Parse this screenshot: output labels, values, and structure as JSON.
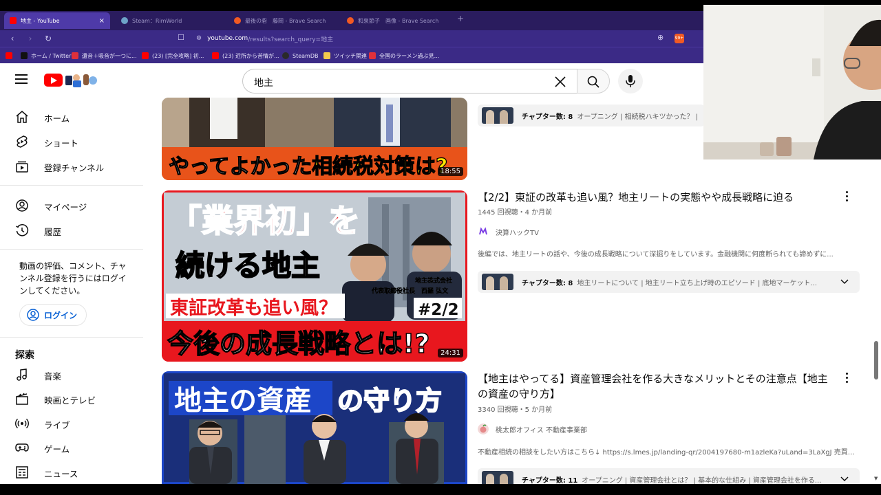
{
  "browser": {
    "tabs": [
      {
        "title": "地主 - YouTube",
        "color": "#ff0000",
        "active": true
      },
      {
        "title": "Steam：RimWorld",
        "color": "#6ea3c8",
        "active": false
      },
      {
        "title": "最後の砦　藤岡 - Brave Search",
        "color": "#f25a23",
        "active": false
      },
      {
        "title": "和泉節子　画像 - Brave Search",
        "color": "#f25a23",
        "active": false
      }
    ],
    "tab_close": "×",
    "new_tab": "+",
    "url_host": "youtube.com",
    "url_path": "/results?search_query=地主",
    "brave_badge": "99+",
    "bookmarks": [
      {
        "label": "",
        "color": "#ff0000"
      },
      {
        "label": "ホーム / Twitter",
        "color": "#111111"
      },
      {
        "label": "遺音＋吸音が一つに...",
        "color": "#e0303a"
      },
      {
        "label": "(23) [完全攻略] 初...",
        "color": "#ff0000"
      },
      {
        "label": "(23) 近所から苦情が...",
        "color": "#ff0000"
      },
      {
        "label": "SteamDB",
        "color": "#2a2a2a"
      },
      {
        "label": "ツイッチ関連",
        "color": "#f2c94c"
      },
      {
        "label": "全国のラーメン過ぶ見...",
        "color": "#e0303a"
      }
    ]
  },
  "masthead": {
    "search_query": "地主"
  },
  "sidebar": {
    "items": [
      {
        "label": "ホーム",
        "icon": "home-icon"
      },
      {
        "label": "ショート",
        "icon": "shorts-icon"
      },
      {
        "label": "登録チャンネル",
        "icon": "subscriptions-icon"
      },
      {
        "label": "マイページ",
        "icon": "account-icon"
      },
      {
        "label": "履歴",
        "icon": "history-icon"
      }
    ],
    "signin_prompt": "動画の評価、コメント、チャンネル登録を行うにはログインしてください。",
    "login_label": "ログイン",
    "explore_title": "探索",
    "explore_items": [
      {
        "label": "音楽",
        "icon": "music-icon"
      },
      {
        "label": "映画とテレビ",
        "icon": "movies-icon"
      },
      {
        "label": "ライブ",
        "icon": "live-icon"
      },
      {
        "label": "ゲーム",
        "icon": "gaming-icon"
      },
      {
        "label": "ニュース",
        "icon": "news-icon"
      }
    ]
  },
  "results": [
    {
      "thumb_caption_a": "やってよかった",
      "thumb_caption_b": "相続税対策は?",
      "duration": "18:55",
      "chapters_count": "チャプター数: 8",
      "chapters": "オープニング | 相続税ハキツかった？ |"
    },
    {
      "title": "【2/2】東証の改革も追い風？地主リートの実態やや成長戦略に迫る",
      "meta": "1445 回視聴・4 か月前",
      "channel": "決算ハックTV",
      "description": "後編では、地主リートの話や、今後の成長戦略について深掘りをしています。金融機関に何度断られても諦めずに...",
      "thumb_line1": "「業界初」を",
      "thumb_line2": "続ける地主",
      "thumb_line3": "東証改革も追い風？",
      "thumb_line4": "今後の成長戦略とは!?",
      "thumb_badge": "#2/2",
      "thumb_company": "地主株式会社",
      "thumb_person": "代表取締役社長　西羅 弘文",
      "duration": "24:31",
      "chapters_count": "チャプター数: 8",
      "chapters": "地主リートについて | 地主リート立ち上げ時のエピソード | 底地マーケット..."
    },
    {
      "title": "【地主はやってる】資産管理会社を作る大きなメリットとその注意点【地主の資産の守り方】",
      "meta": "3340 回視聴・5 か月前",
      "channel": "桃太郎オフィス 不動産事業部",
      "description": "不動産相続の相談をしたい方はこちら↓ https://s.lmes.jp/landing-qr/2004197680-m1azleKa?uLand=3LaXgJ 売買の...",
      "thumb_line1a": "地主の資産",
      "thumb_line1b": "の守り方",
      "chapters_count": "チャプター数: 11",
      "chapters": "オープニング | 資産管理会社とは？ | 基本的な仕組み | 資産管理会社を作る..."
    }
  ],
  "colors": {
    "tabbar": "#2a1c5e",
    "urlbar": "#3b2a86",
    "youtube_red": "#ff0000",
    "link_blue": "#065fd4"
  }
}
